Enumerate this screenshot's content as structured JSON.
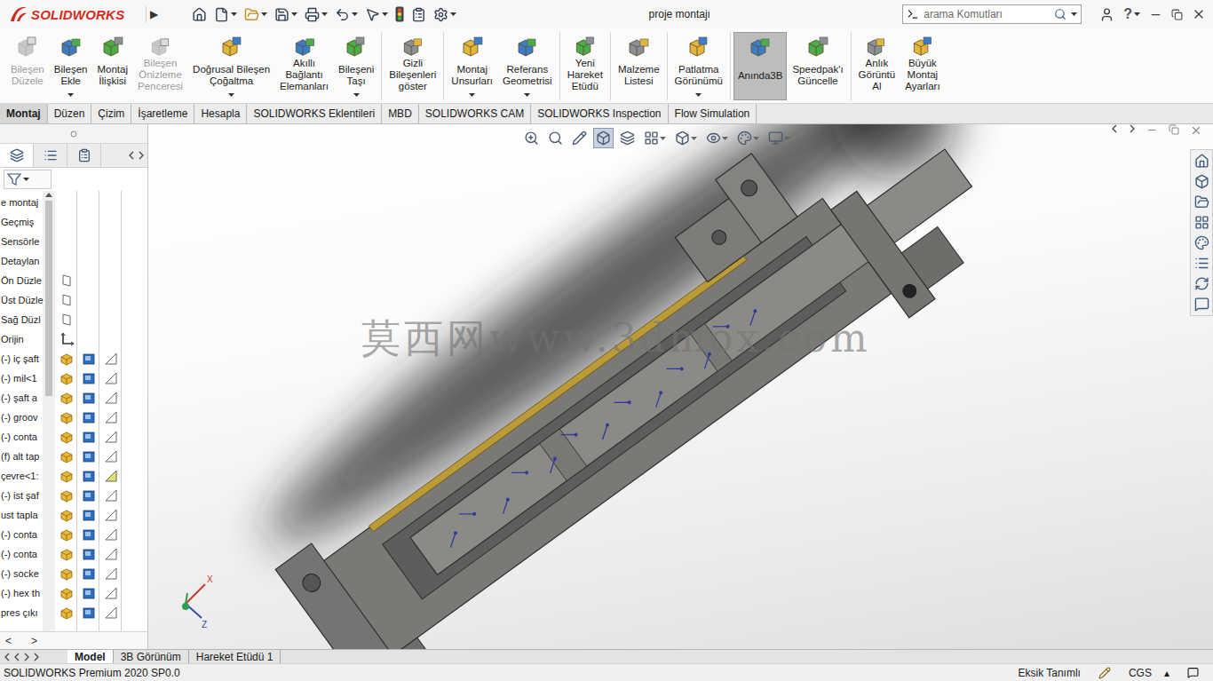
{
  "window": {
    "logo": "SOLIDWORKS",
    "menu_arrow": "▶",
    "title": "proje montajı",
    "help": "?"
  },
  "search": {
    "placeholder": "arama Komutları"
  },
  "ribbon": {
    "groups": [
      [
        {
          "lines": [
            "Bileşen",
            "Düzele"
          ],
          "disabled": true,
          "dropdown": false,
          "selected": false
        },
        {
          "lines": [
            "Bileşen",
            "Ekle"
          ],
          "disabled": false,
          "dropdown": true,
          "selected": false
        },
        {
          "lines": [
            "Montaj",
            "İlişkisi"
          ],
          "disabled": false,
          "dropdown": false,
          "selected": false
        },
        {
          "lines": [
            "Bileşen",
            "Önizleme",
            "Penceresi"
          ],
          "disabled": true,
          "dropdown": false,
          "selected": false
        },
        {
          "lines": [
            "Doğrusal Bileşen",
            "Çoğaltma"
          ],
          "disabled": false,
          "dropdown": true,
          "selected": false
        },
        {
          "lines": [
            "Akıllı",
            "Bağlantı",
            "Elemanları"
          ],
          "disabled": false,
          "dropdown": false,
          "selected": false
        },
        {
          "lines": [
            "Bileşeni",
            "Taşı"
          ],
          "disabled": false,
          "dropdown": true,
          "selected": false
        }
      ],
      [
        {
          "lines": [
            "Gizli",
            "Bileşenleri",
            "göster"
          ],
          "disabled": false,
          "dropdown": false,
          "selected": false
        }
      ],
      [
        {
          "lines": [
            "Montaj",
            "Unsurları"
          ],
          "disabled": false,
          "dropdown": true,
          "selected": false
        },
        {
          "lines": [
            "Referans",
            "Geometrisi"
          ],
          "disabled": false,
          "dropdown": true,
          "selected": false
        }
      ],
      [
        {
          "lines": [
            "Yeni",
            "Hareket",
            "Etüdü"
          ],
          "disabled": false,
          "dropdown": false,
          "selected": false
        }
      ],
      [
        {
          "lines": [
            "Malzeme",
            "Listesi"
          ],
          "disabled": false,
          "dropdown": false,
          "selected": false
        }
      ],
      [
        {
          "lines": [
            "Patlatma",
            "Görünümü"
          ],
          "disabled": false,
          "dropdown": true,
          "selected": false
        }
      ],
      [
        {
          "lines": [
            "Anında3B"
          ],
          "disabled": false,
          "dropdown": false,
          "selected": true
        },
        {
          "lines": [
            "Speedpak'ı",
            "Güncelle"
          ],
          "disabled": false,
          "dropdown": false,
          "selected": false
        }
      ],
      [
        {
          "lines": [
            "Anlık",
            "Görüntü",
            "Al"
          ],
          "disabled": false,
          "dropdown": false,
          "selected": false
        },
        {
          "lines": [
            "Büyük",
            "Montaj",
            "Ayarları"
          ],
          "disabled": false,
          "dropdown": false,
          "selected": false
        }
      ]
    ]
  },
  "tabs": [
    {
      "label": "Montaj",
      "selected": true
    },
    {
      "label": "Düzen",
      "selected": false
    },
    {
      "label": "Çizim",
      "selected": false
    },
    {
      "label": "İşaretleme",
      "selected": false
    },
    {
      "label": "Hesapla",
      "selected": false
    },
    {
      "label": "SOLIDWORKS Eklentileri",
      "selected": false
    },
    {
      "label": "MBD",
      "selected": false
    },
    {
      "label": "SOLIDWORKS CAM",
      "selected": false
    },
    {
      "label": "SOLIDWORKS Inspection",
      "selected": false
    },
    {
      "label": "Flow Simulation",
      "selected": false
    }
  ],
  "tree": {
    "items": [
      {
        "label": "e montaj",
        "kind": "root",
        "highlight": false
      },
      {
        "label": "Geçmiş",
        "kind": "folder",
        "highlight": false
      },
      {
        "label": "Sensörle",
        "kind": "folder",
        "highlight": false
      },
      {
        "label": "Detaylan",
        "kind": "folder",
        "highlight": false
      },
      {
        "label": "Ön Düzle",
        "kind": "plane",
        "highlight": false
      },
      {
        "label": "Üst Düzle",
        "kind": "plane",
        "highlight": false
      },
      {
        "label": "Sağ Düzl",
        "kind": "plane",
        "highlight": false
      },
      {
        "label": "Orijin",
        "kind": "origin",
        "highlight": false
      },
      {
        "label": "(-) iç şaft",
        "kind": "part",
        "highlight": false
      },
      {
        "label": "(-) mil<1",
        "kind": "part",
        "highlight": false
      },
      {
        "label": "(-) şaft a",
        "kind": "part",
        "highlight": false
      },
      {
        "label": "(-) groov",
        "kind": "part",
        "highlight": false
      },
      {
        "label": "(-) conta",
        "kind": "part",
        "highlight": false
      },
      {
        "label": "(f) alt tap",
        "kind": "part",
        "highlight": false
      },
      {
        "label": "çevre<1:",
        "kind": "part",
        "highlight": true
      },
      {
        "label": "(-) ist şaf",
        "kind": "part",
        "highlight": false
      },
      {
        "label": "ust tapla",
        "kind": "part",
        "highlight": false
      },
      {
        "label": "(-) conta",
        "kind": "part",
        "highlight": false
      },
      {
        "label": "(-) conta",
        "kind": "part",
        "highlight": false
      },
      {
        "label": "(-) socke",
        "kind": "part",
        "highlight": false
      },
      {
        "label": "(-) hex th",
        "kind": "part",
        "highlight": false
      },
      {
        "label": "pres çıkı",
        "kind": "part",
        "highlight": false
      }
    ],
    "scroll": [
      "<",
      ">"
    ]
  },
  "viewport": {
    "watermark": "莫西网www.3dmox.com",
    "axes": [
      "X",
      "Z"
    ],
    "hud": [
      {
        "pressed": false,
        "dropdown": false
      },
      {
        "pressed": false,
        "dropdown": false
      },
      {
        "pressed": false,
        "dropdown": false
      },
      {
        "pressed": true,
        "dropdown": false
      },
      {
        "pressed": false,
        "dropdown": false
      },
      {
        "pressed": false,
        "dropdown": true
      },
      {
        "pressed": false,
        "dropdown": true
      },
      {
        "pressed": false,
        "dropdown": true
      },
      {
        "pressed": false,
        "dropdown": true
      },
      {
        "pressed": false,
        "dropdown": true
      }
    ]
  },
  "bottom_tabs": [
    {
      "label": "Model",
      "selected": true
    },
    {
      "label": "3B Görünüm",
      "selected": false
    },
    {
      "label": "Hareket Etüdü 1",
      "selected": false
    }
  ],
  "status_bar": {
    "product": "SOLIDWORKS Premium 2020 SP0.0",
    "state": "Eksik Tanımlı",
    "units": "CGS",
    "units_arrow": "▴"
  }
}
